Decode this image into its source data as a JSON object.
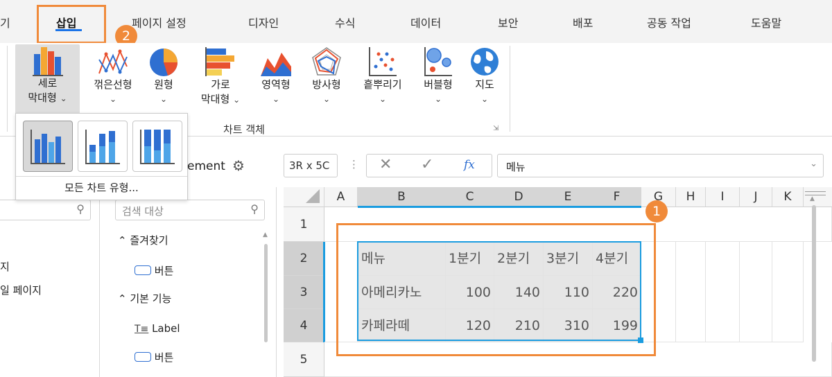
{
  "menu": {
    "tabs": [
      "기",
      "삽입",
      "페이지 설정",
      "디자인",
      "수식",
      "데이터",
      "보안",
      "배포",
      "공동 작업",
      "도움말"
    ],
    "active": "삽입"
  },
  "badges": {
    "one": "1",
    "two": "2"
  },
  "ribbon": {
    "column": {
      "line1": "세로",
      "line2": "막대형"
    },
    "line": "꺾은선형",
    "pie": "원형",
    "bar": {
      "line1": "가로",
      "line2": "막대형"
    },
    "area": "영역형",
    "radar": "방사형",
    "scatter": "흩뿌리기",
    "bubble": "버블형",
    "map": "지도",
    "group_label": "차트 객체"
  },
  "dropdown": {
    "all_types": "모든 차트 유형..."
  },
  "left_panel": {
    "item1": "지",
    "item2": "일 페이지"
  },
  "components": {
    "header_suffix": "ement",
    "search_placeholder": "검색 대상",
    "favorites": "즐겨찾기",
    "button1": "버튼",
    "basic": "기본 기능",
    "label": "Label",
    "button2": "버튼"
  },
  "formula": {
    "name_box": "3R x 5C",
    "fx": "fx",
    "value": "메뉴"
  },
  "sheet": {
    "columns": [
      "A",
      "B",
      "C",
      "D",
      "E",
      "F",
      "G",
      "H",
      "I",
      "J",
      "K"
    ],
    "rows": [
      "1",
      "2",
      "3",
      "4",
      "5"
    ],
    "table": {
      "header": [
        "메뉴",
        "1분기",
        "2분기",
        "3분기",
        "4분기"
      ],
      "r1": [
        "아메리카노",
        "100",
        "140",
        "110",
        "220"
      ],
      "r2": [
        "카페라떼",
        "120",
        "210",
        "310",
        "199"
      ]
    }
  },
  "colors": {
    "accent": "#f08a3a",
    "selection": "#1a9ce0",
    "active_tab": "#1a73e8"
  }
}
